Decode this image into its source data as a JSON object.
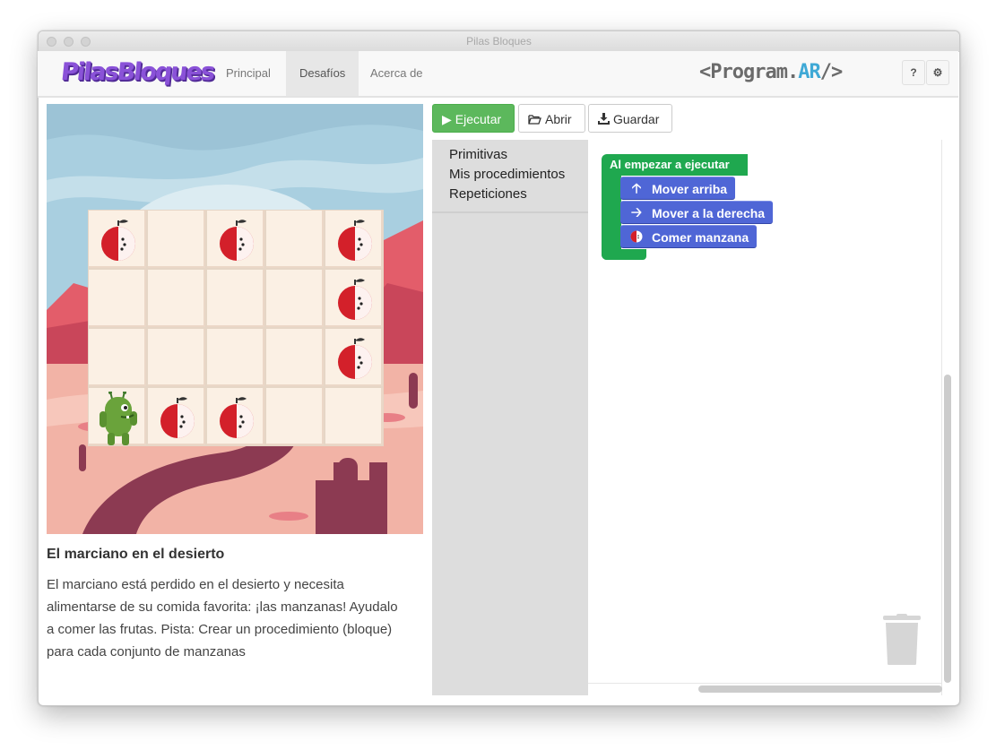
{
  "window": {
    "title": "Pilas Bloques"
  },
  "navbar": {
    "logo": "PilasBloques",
    "items": [
      {
        "label": "Principal",
        "active": false
      },
      {
        "label": "Desafíos",
        "active": true
      },
      {
        "label": "Acerca de",
        "active": false
      }
    ],
    "brand_prefix": "<Program.",
    "brand_ar": "AR",
    "brand_suffix": "/>",
    "help_label": "?",
    "settings_icon": "gear-icon"
  },
  "toolbar": {
    "run_label": "Ejecutar",
    "open_label": "Abrir",
    "save_label": "Guardar"
  },
  "challenge": {
    "title": "El marciano en el desierto",
    "description": "El marciano está perdido en el desierto y necesita alimentarse de su comida favorita: ¡las manzanas! Ayudalo a comer las frutas. Pista: Crear un procedimiento (bloque) para cada conjunto de manzanas"
  },
  "board": {
    "rows": 4,
    "cols": 5,
    "apples": [
      [
        0,
        0
      ],
      [
        0,
        2
      ],
      [
        0,
        4
      ],
      [
        1,
        4
      ],
      [
        2,
        4
      ],
      [
        3,
        1
      ],
      [
        3,
        2
      ]
    ],
    "martian": [
      3,
      0
    ]
  },
  "toolbox": {
    "categories": [
      "Primitivas",
      "Mis procedimientos",
      "Repeticiones"
    ]
  },
  "program": {
    "hat_label": "Al empezar a ejecutar",
    "blocks": [
      {
        "label": "Mover arriba",
        "icon": "arrow-up-icon"
      },
      {
        "label": "Mover a la derecha",
        "icon": "arrow-right-icon"
      },
      {
        "label": "Comer manzana",
        "icon": "apple-icon"
      }
    ]
  },
  "colors": {
    "run_button": "#5cb85c",
    "event_block": "#1fa84f",
    "action_block": "#4f66d6",
    "sky": "#a9cfe0",
    "ground": "#f2b3a6"
  }
}
